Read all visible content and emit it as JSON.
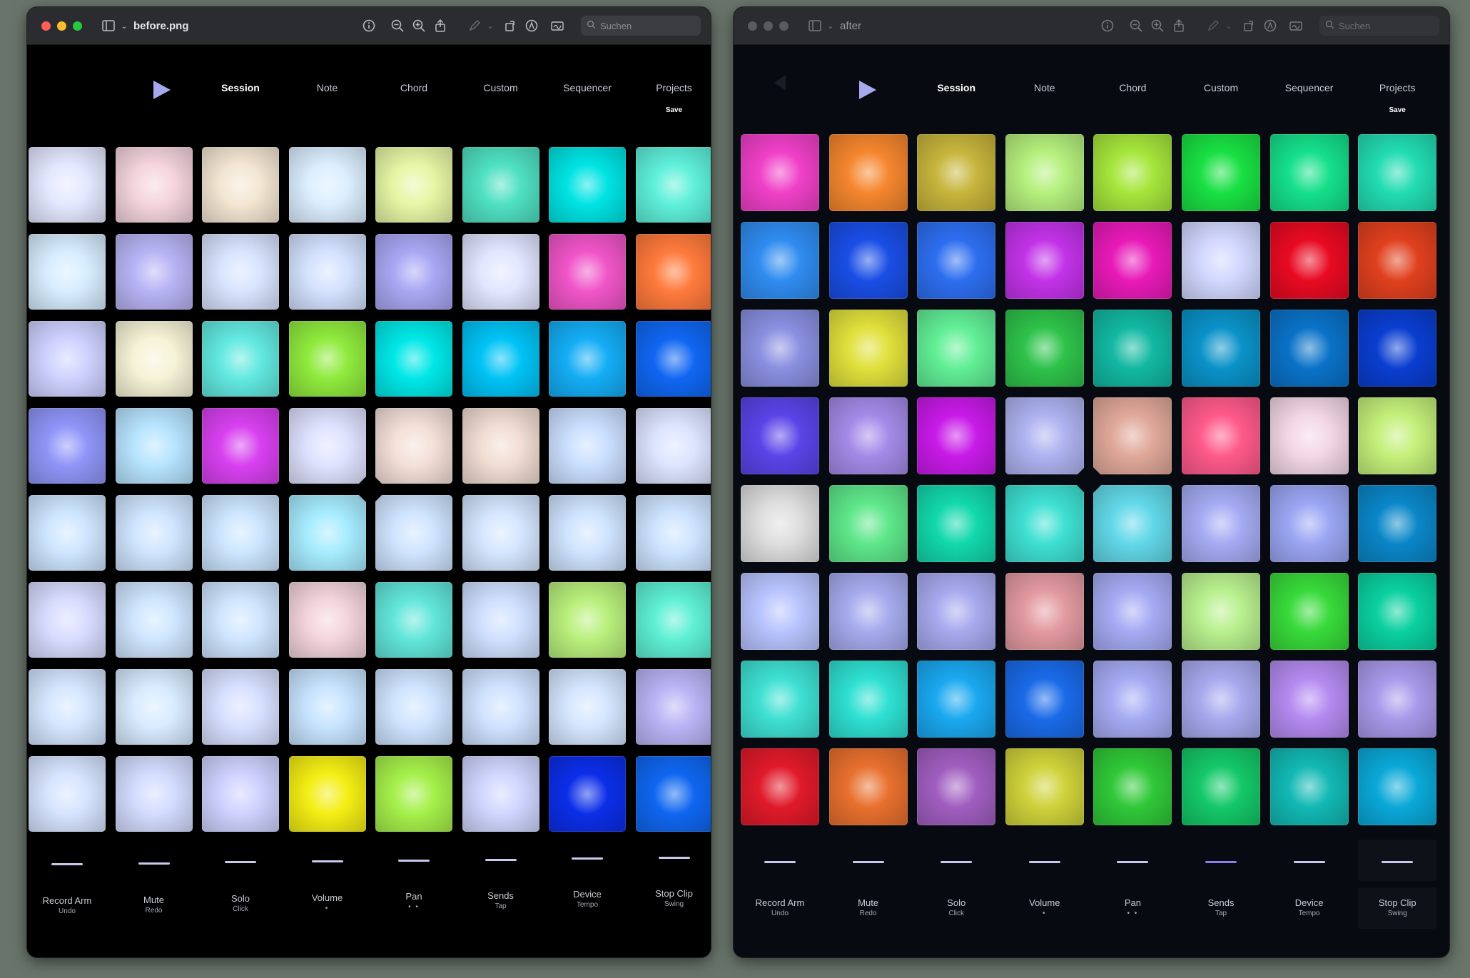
{
  "windows": [
    {
      "id": "before",
      "title": "before.png",
      "active": true,
      "search_placeholder": "Suchen",
      "nav": {
        "play_icon": "play-triangle-icon",
        "items": [
          {
            "label": "Session",
            "active": true
          },
          {
            "label": "Note"
          },
          {
            "label": "Chord"
          },
          {
            "label": "Custom"
          },
          {
            "label": "Sequencer"
          },
          {
            "label": "Projects",
            "sub": "Save"
          }
        ]
      },
      "pad_rows": [
        [
          "#e4e8ff",
          "#f5d4de",
          "#f3e6d2",
          "#dbeeff",
          "#e7f6a5",
          "#4fe0c2",
          "#00e3e3",
          "#5ef0da"
        ],
        [
          "#d7edff",
          "#b7b4f5",
          "#d8e4ff",
          "#d4e2ff",
          "#a8a7f3",
          "#e2e6ff",
          "#f055c8",
          "#ff7a3c"
        ],
        [
          "#cfd2ff",
          "#f6f3d6",
          "#62e9e0",
          "#8fea3d",
          "#00e7e7",
          "#00c3f5",
          "#14adf5",
          "#1066f2"
        ],
        [
          "#8f95f8",
          "#b7e4ff",
          "#d840f0",
          "#dfe2ff",
          "#f3dfd8",
          "#f1ddd2",
          "#cadfff",
          "#dce4ff"
        ],
        [
          "#cde6ff",
          "#cfe5ff",
          "#cce6ff",
          "#a6ecff",
          "#cfe4ff",
          "#d4e6ff",
          "#cfe4ff",
          "#cde4ff"
        ],
        [
          "#d8dcff",
          "#cfe6ff",
          "#cfe6ff",
          "#f4d4dc",
          "#62e6da",
          "#cfe0ff",
          "#b9f07c",
          "#5ef0d4"
        ],
        [
          "#d4e6ff",
          "#d8ebff",
          "#d7e0ff",
          "#c7e4ff",
          "#cfe4ff",
          "#cfe2ff",
          "#d4e6ff",
          "#b9b4f5"
        ],
        [
          "#d6e4ff",
          "#d3dcff",
          "#cfd2ff",
          "#f4ee14",
          "#a5f04a",
          "#d0d6ff",
          "#0b2ee8",
          "#0f66f0"
        ]
      ],
      "bottom_bar_colors": [
        "#c9c9f0",
        "#c9c9f0",
        "#c9c9f0",
        "#c9c9f0",
        "#c9c9f0",
        "#c9c9f0",
        "#c9c9f0",
        "#c9c9f0"
      ],
      "bottom_labels": [
        {
          "label": "Record Arm",
          "sub": "Undo"
        },
        {
          "label": "Mute",
          "sub": "Redo"
        },
        {
          "label": "Solo",
          "sub": "Click"
        },
        {
          "label": "Volume",
          "dots": "•"
        },
        {
          "label": "Pan",
          "dots": "• •"
        },
        {
          "label": "Sends",
          "sub": "Tap"
        },
        {
          "label": "Device",
          "sub": "Tempo"
        },
        {
          "label": "Stop Clip",
          "sub": "Swing"
        }
      ]
    },
    {
      "id": "after",
      "title": "after",
      "active": false,
      "search_placeholder": "Suchen",
      "nav": {
        "back_icon": "back-triangle-icon",
        "play_icon": "play-triangle-icon",
        "items": [
          {
            "label": "Session",
            "active": true
          },
          {
            "label": "Note"
          },
          {
            "label": "Chord"
          },
          {
            "label": "Custom"
          },
          {
            "label": "Sequencer"
          },
          {
            "label": "Projects",
            "sub": "Save"
          }
        ]
      },
      "pad_rows": [
        [
          "#f040c8",
          "#f5862e",
          "#c7b53c",
          "#b5f07d",
          "#a6e63c",
          "#19e043",
          "#15e08a",
          "#22dcb2"
        ],
        [
          "#2f8cf0",
          "#1a4ee6",
          "#2d6ef0",
          "#c232e8",
          "#e81ab8",
          "#d2d7ff",
          "#e80a22",
          "#e0401e"
        ],
        [
          "#8a8fe0",
          "#e0e03c",
          "#62ef96",
          "#2ec24a",
          "#12b8a2",
          "#0a92c8",
          "#0a72c8",
          "#0a3ed0"
        ],
        [
          "#5a44e8",
          "#a48ae8",
          "#c81ae8",
          "#aeb2f0",
          "#e0a89a",
          "#ff5a8a",
          "#f3d7e5",
          "#c4f07a"
        ],
        [
          "#dedede",
          "#5ee78a",
          "#12d8ac",
          "#3ee0d2",
          "#62d8e8",
          "#a5abf3",
          "#9aa6f3",
          "#0a86c8"
        ],
        [
          "#b8c4ff",
          "#a6abee",
          "#a7a9ee",
          "#e29aa0",
          "#a5abf3",
          "#b8f08e",
          "#38da3a",
          "#0ad0a0"
        ],
        [
          "#3ee0d2",
          "#2ee0d2",
          "#1aa8f0",
          "#1a6ae8",
          "#a5abf3",
          "#a7a9ee",
          "#b48af0",
          "#a899ea"
        ],
        [
          "#e01a2a",
          "#e8702e",
          "#a05ec0",
          "#cfd23a",
          "#30c838",
          "#14c868",
          "#12b8b4",
          "#0aa8d8"
        ]
      ],
      "bottom_bar_colors": [
        "#c9c9f0",
        "#c9c9f0",
        "#c9c9f0",
        "#c9c9f0",
        "#c9c9f0",
        "#8a7ef0",
        "#c9c9f0",
        "#c9c9f0"
      ],
      "bottom_labels": [
        {
          "label": "Record Arm",
          "sub": "Undo"
        },
        {
          "label": "Mute",
          "sub": "Redo"
        },
        {
          "label": "Solo",
          "sub": "Click"
        },
        {
          "label": "Volume",
          "dots": "•"
        },
        {
          "label": "Pan",
          "dots": "• •"
        },
        {
          "label": "Sends",
          "sub": "Tap"
        },
        {
          "label": "Device",
          "sub": "Tempo"
        },
        {
          "label": "Stop Clip",
          "sub": "Swing"
        }
      ]
    }
  ],
  "titlebar_icons": [
    "sidebar-icon",
    "chevron-down-icon",
    "info-icon",
    "zoom-out-icon",
    "zoom-in-icon",
    "share-icon",
    "markup-pen-icon",
    "chevron-down-icon",
    "rotate-icon",
    "annotate-icon",
    "signature-icon"
  ],
  "colors": {
    "traffic_red": "#ff5f57",
    "traffic_yellow": "#febc2e",
    "traffic_green": "#28c840",
    "nav_play": "#a7a9ee"
  }
}
